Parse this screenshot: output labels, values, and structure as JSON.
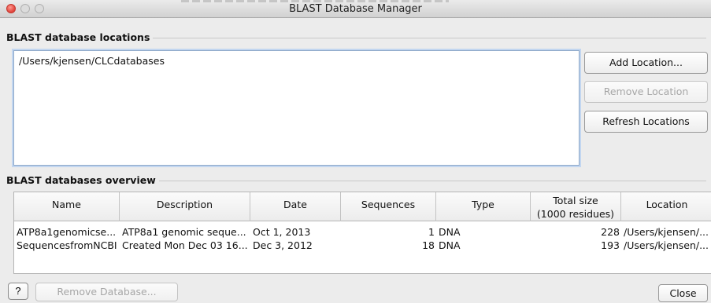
{
  "window": {
    "title": "BLAST Database Manager"
  },
  "locations": {
    "group_label": "BLAST database locations",
    "items": [
      "/Users/kjensen/CLCdatabases"
    ],
    "add_label": "Add Location...",
    "remove_label": "Remove Location",
    "refresh_label": "Refresh Locations"
  },
  "overview": {
    "group_label": "BLAST databases overview",
    "columns": [
      "Name",
      "Description",
      "Date",
      "Sequences",
      "Type",
      "Total size",
      "(1000 residues)",
      "Location"
    ],
    "rows": [
      {
        "name": "ATP8a1genomicse...",
        "description": "ATP8a1 genomic seque...",
        "date": "Oct 1, 2013",
        "sequences": "1",
        "type": "DNA",
        "total_size": "228",
        "location": "/Users/kjensen/..."
      },
      {
        "name": "SequencesfromNCBI",
        "description": "Created Mon Dec 03 16...",
        "date": "Dec 3, 2012",
        "sequences": "18",
        "type": "DNA",
        "total_size": "193",
        "location": "/Users/kjensen/..."
      }
    ]
  },
  "footer": {
    "help_label": "?",
    "remove_db_label": "Remove Database...",
    "close_label": "Close"
  }
}
